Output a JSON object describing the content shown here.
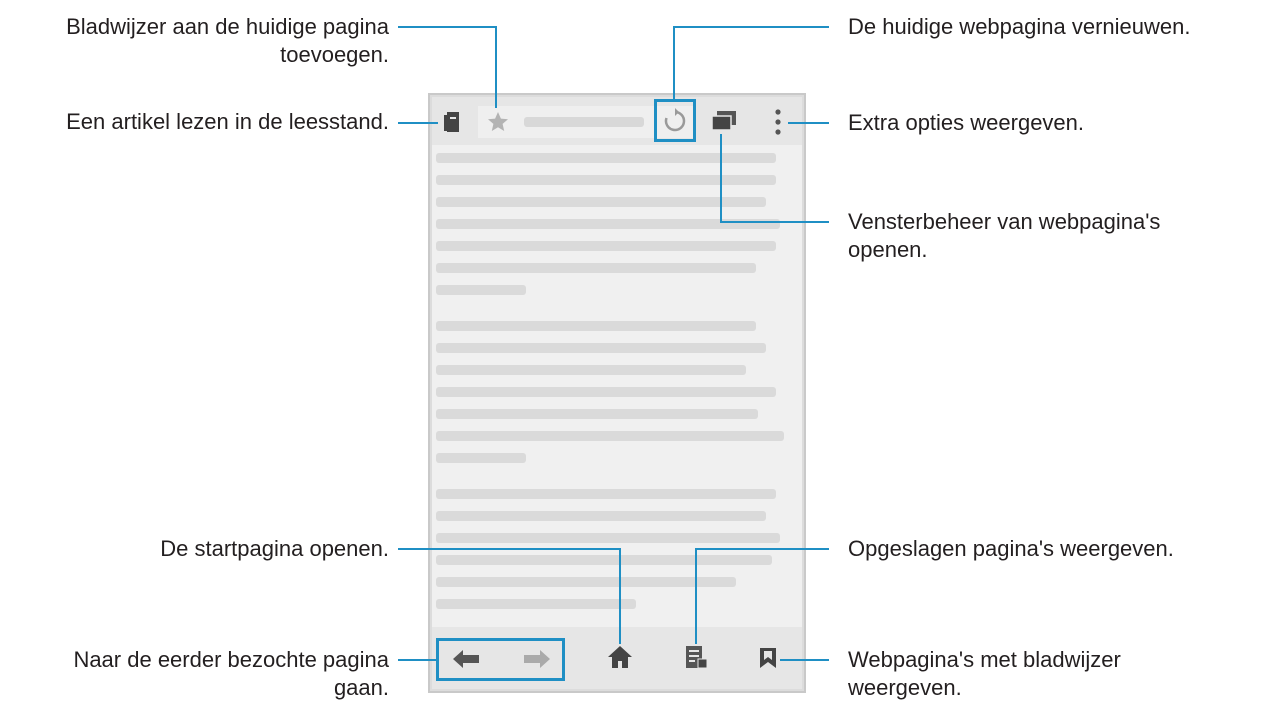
{
  "callouts": {
    "bookmark_add": {
      "line1": "Bladwijzer aan de huidige pagina",
      "line2": "toevoegen."
    },
    "reader_mode": "Een artikel lezen in de leesstand.",
    "refresh": "De huidige webpagina vernieuwen.",
    "more_options": "Extra opties weergeven.",
    "window_manager": {
      "line1": "Vensterbeheer van webpagina's",
      "line2": "openen."
    },
    "homepage": "De startpagina openen.",
    "saved_pages": "Opgeslagen pagina's weergeven.",
    "previous_pages": {
      "line1": "Naar de eerder bezochte pagina",
      "line2": "gaan."
    },
    "bookmarked_pages": {
      "line1": "Webpagina's met bladwijzer",
      "line2": "weergeven."
    }
  },
  "icons": {
    "reader": "reader-icon",
    "star": "star-icon",
    "refresh": "refresh-icon",
    "windows": "windows-icon",
    "more": "more-vertical-icon",
    "back": "arrow-left-icon",
    "forward": "arrow-right-icon",
    "home": "home-icon",
    "saved": "saved-pages-icon",
    "bookmarks": "bookmark-icon"
  },
  "colors": {
    "callout_line": "#1f8fc4",
    "text": "#231f20",
    "icon": "#444444",
    "icon_disabled": "#aaaaaa"
  }
}
